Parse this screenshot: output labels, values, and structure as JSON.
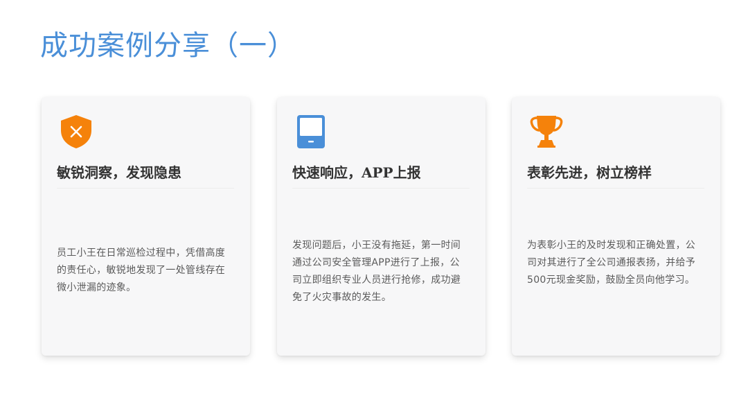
{
  "page": {
    "title": "成功案例分享（一）"
  },
  "cards": [
    {
      "icon": "shield-x-icon",
      "icon_color": "#f5820b",
      "heading": "敏锐洞察，发现隐患",
      "body": "员工小王在日常巡检过程中，凭借高度的责任心，敏锐地发现了一处管线存在微小泄漏的迹象。"
    },
    {
      "icon": "mobile-device-icon",
      "icon_color": "#4a8fd8",
      "heading": "快速响应，APP上报",
      "body": "发现问题后，小王没有拖延，第一时间通过公司安全管理APP进行了上报，公司立即组织专业人员进行抢修，成功避免了火灾事故的发生。"
    },
    {
      "icon": "trophy-icon",
      "icon_color": "#f5820b",
      "heading": "表彰先进，树立榜样",
      "body": "为表彰小王的及时发现和正确处置，公司对其进行了全公司通报表扬，并给予500元现金奖励，鼓励全员向他学习。"
    }
  ]
}
